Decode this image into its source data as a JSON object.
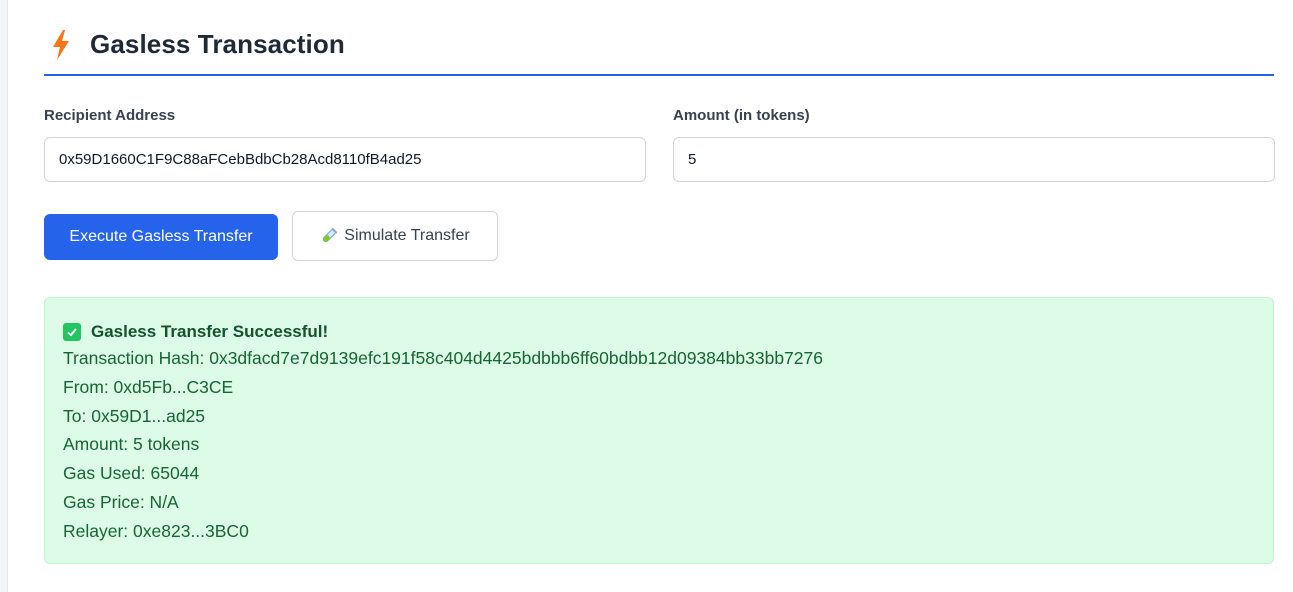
{
  "header": {
    "title": "Gasless Transaction",
    "icon": "lightning-bolt-icon"
  },
  "form": {
    "recipient": {
      "label": "Recipient Address",
      "value": "0x59D1660C1F9C88aFCebBdbCb28Acd8110fB4ad25"
    },
    "amount": {
      "label": "Amount (in tokens)",
      "value": "5"
    }
  },
  "actions": {
    "execute_label": "Execute Gasless Transfer",
    "simulate_label": "Simulate Transfer",
    "simulate_icon": "test-tube-icon"
  },
  "result": {
    "title": "Gasless Transfer Successful!",
    "hash": "Transaction Hash: 0x3dfacd7e7d9139efc191f58c404d4425bdbbb6ff60bdbb12d09384bb33bb7276",
    "from": "From: 0xd5Fb...C3CE",
    "to": "To: 0x59D1...ad25",
    "amount": "Amount: 5 tokens",
    "gas_used": "Gas Used: 65044",
    "gas_price": "Gas Price: N/A",
    "relayer": "Relayer: 0xe823...3BC0"
  },
  "colors": {
    "accent": "#2563eb",
    "success_bg": "#dcfce7",
    "success_text": "#166534",
    "bolt": "#f97316"
  }
}
